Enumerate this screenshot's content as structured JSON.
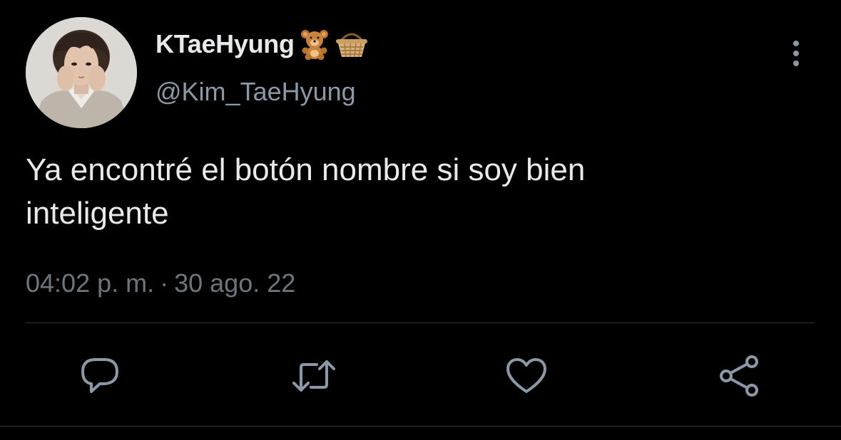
{
  "tweet": {
    "display_name": "KTaeHyung",
    "name_emojis": [
      "teddy-bear-emoji",
      "basket-emoji"
    ],
    "handle": "@Kim_TaeHyung",
    "text": "Ya encontré el botón nombre si soy bien\ninteligente",
    "time": "04:02 p. m.",
    "separator": "·",
    "date": "30 ago. 22"
  },
  "actions": {
    "reply_icon": "speech-bubble-icon",
    "retweet_icon": "retweet-arrows-icon",
    "like_icon": "heart-outline-icon",
    "share_icon": "share-nodes-icon"
  },
  "colors": {
    "background": "#000000",
    "primary_text": "#e7e9ea",
    "secondary_text": "#8b98a5",
    "meta_text": "#6e767d",
    "divider": "#2f3336"
  }
}
